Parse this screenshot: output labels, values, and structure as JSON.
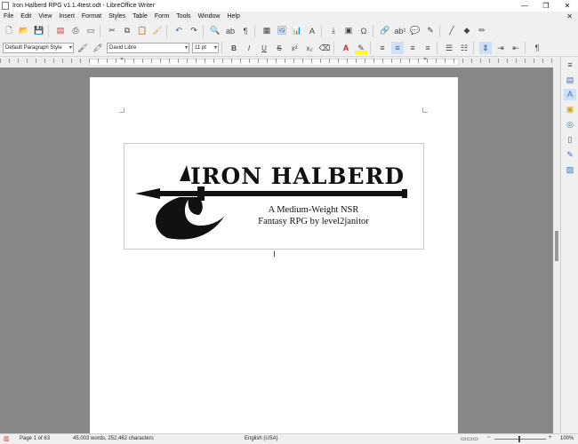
{
  "window": {
    "title": "Iron Halberd RPG v1.1.4test.odt - LibreOffice Writer",
    "controls": {
      "minimize": "—",
      "maximize": "❐",
      "close": "✕"
    }
  },
  "menu": {
    "items": [
      "File",
      "Edit",
      "View",
      "Insert",
      "Format",
      "Styles",
      "Table",
      "Form",
      "Tools",
      "Window",
      "Help"
    ],
    "close_doc": "✕"
  },
  "toolbar": {
    "paragraph_style": "Default Paragraph Style",
    "font_name": "David Libre",
    "font_size": "11 pt",
    "bold": "B",
    "italic": "I",
    "underline": "U",
    "strikethrough": "S",
    "superscript": "x²",
    "subscript": "x₂"
  },
  "document": {
    "logo_text": "IRON HALBERD",
    "subtitle_line1": "A Medium-Weight NSR",
    "subtitle_line2": "Fantasy RPG by level2janitor"
  },
  "status": {
    "page": "Page 1 of 63",
    "words": "45,003 words, 252,462 characters",
    "language": "English (USA)",
    "zoom": "100%"
  },
  "colors": {
    "font_color": "#c9211e",
    "highlight_color": "#ffff00",
    "workspace": "#878787",
    "accent": "#3a6fb0"
  }
}
